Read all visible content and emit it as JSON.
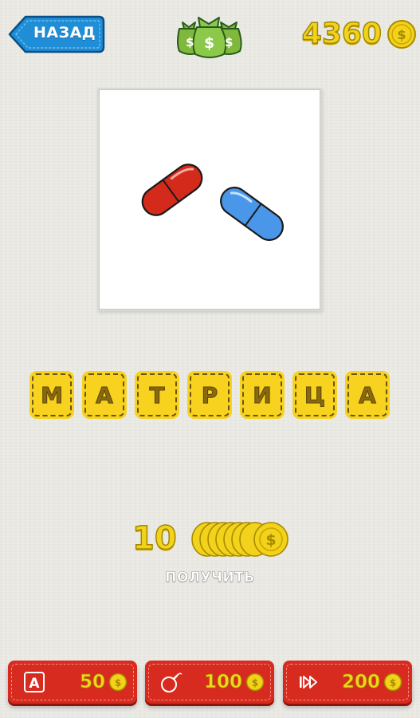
{
  "header": {
    "back_label": "НАЗАД",
    "coins": "4360",
    "bags_icon": "money-bags-icon",
    "coin_icon": "gold-coin-icon"
  },
  "puzzle": {
    "image": "red-and-blue-pills",
    "answer_letters": [
      "М",
      "А",
      "Т",
      "Р",
      "И",
      "Ц",
      "А"
    ]
  },
  "reward": {
    "amount": "10",
    "caption": "ПОЛУЧИТЬ"
  },
  "hints": [
    {
      "icon": "reveal-letter-icon",
      "icon_text": "A",
      "price": "50"
    },
    {
      "icon": "bomb-icon",
      "price": "100"
    },
    {
      "icon": "skip-icon",
      "price": "200"
    }
  ],
  "colors": {
    "background": "#ecebe6",
    "back_button": "#1f8ed6",
    "coin_yellow": "#f2d21a",
    "tile_yellow": "#f7d21e",
    "hint_red": "#d72b1f",
    "pill_red": "#d32a1c",
    "pill_blue": "#4a96e8"
  }
}
